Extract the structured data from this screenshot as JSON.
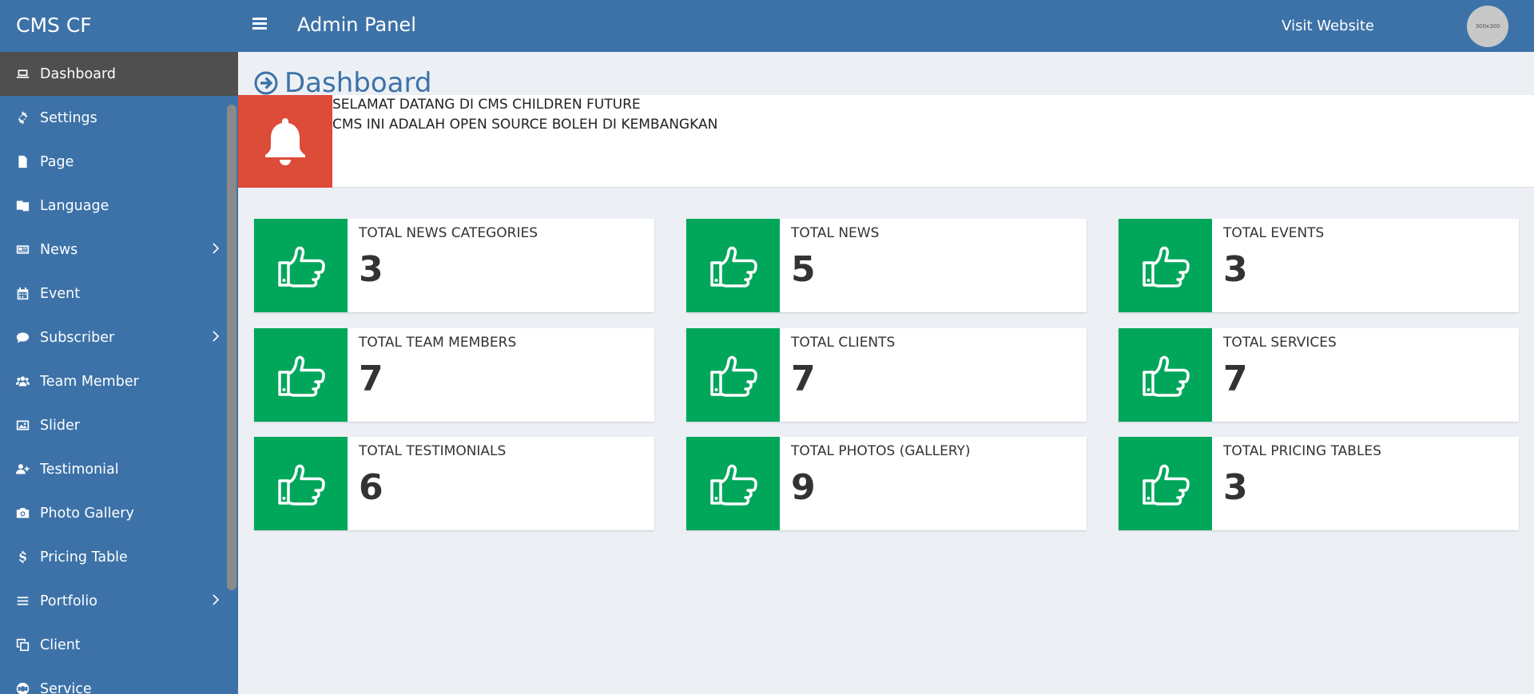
{
  "header": {
    "brand": "CMS CF",
    "title": "Admin Panel",
    "visit_label": "Visit Website",
    "avatar_text": "300x300"
  },
  "sidebar": {
    "items": [
      {
        "label": "Dashboard",
        "icon": "laptop-icon",
        "active": true,
        "has_submenu": false
      },
      {
        "label": "Settings",
        "icon": "gear-icon",
        "active": false,
        "has_submenu": false
      },
      {
        "label": "Page",
        "icon": "file-icon",
        "active": false,
        "has_submenu": false
      },
      {
        "label": "Language",
        "icon": "language-icon",
        "active": false,
        "has_submenu": false
      },
      {
        "label": "News",
        "icon": "newspaper-icon",
        "active": false,
        "has_submenu": true
      },
      {
        "label": "Event",
        "icon": "calendar-icon",
        "active": false,
        "has_submenu": false
      },
      {
        "label": "Subscriber",
        "icon": "comment-icon",
        "active": false,
        "has_submenu": true
      },
      {
        "label": "Team Member",
        "icon": "users-icon",
        "active": false,
        "has_submenu": false
      },
      {
        "label": "Slider",
        "icon": "image-icon",
        "active": false,
        "has_submenu": false
      },
      {
        "label": "Testimonial",
        "icon": "user-plus-icon",
        "active": false,
        "has_submenu": false
      },
      {
        "label": "Photo Gallery",
        "icon": "camera-icon",
        "active": false,
        "has_submenu": false
      },
      {
        "label": "Pricing Table",
        "icon": "dollar-icon",
        "active": false,
        "has_submenu": false
      },
      {
        "label": "Portfolio",
        "icon": "bars-icon",
        "active": false,
        "has_submenu": true
      },
      {
        "label": "Client",
        "icon": "clone-icon",
        "active": false,
        "has_submenu": false
      },
      {
        "label": "Service",
        "icon": "life-ring-icon",
        "active": false,
        "has_submenu": false
      }
    ]
  },
  "main": {
    "heading": "Dashboard",
    "welcome": {
      "line1": "SELAMAT DATANG DI CMS CHILDREN FUTURE",
      "line2": "CMS INI ADALAH OPEN SOURCE BOLEH DI KEMBANGKAN"
    },
    "stats": [
      {
        "label": "TOTAL NEWS CATEGORIES",
        "value": "3"
      },
      {
        "label": "TOTAL NEWS",
        "value": "5"
      },
      {
        "label": "TOTAL EVENTS",
        "value": "3"
      },
      {
        "label": "TOTAL TEAM MEMBERS",
        "value": "7"
      },
      {
        "label": "TOTAL CLIENTS",
        "value": "7"
      },
      {
        "label": "TOTAL SERVICES",
        "value": "7"
      },
      {
        "label": "TOTAL TESTIMONIALS",
        "value": "6"
      },
      {
        "label": "TOTAL PHOTOS (GALLERY)",
        "value": "9"
      },
      {
        "label": "TOTAL PRICING TABLES",
        "value": "3"
      }
    ]
  },
  "colors": {
    "primary": "#3c72a8",
    "sidebar_active": "#4f4f4f",
    "success": "#00a65a",
    "danger": "#dd4b39",
    "content_bg": "#ecf0f5"
  }
}
